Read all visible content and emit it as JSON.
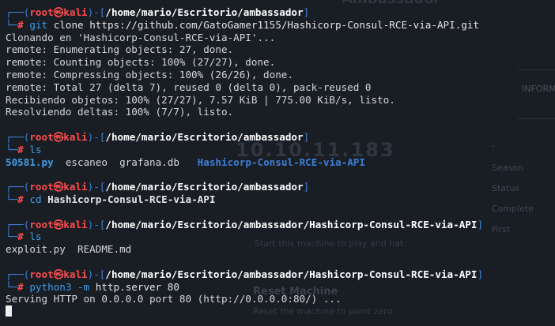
{
  "background_page": {
    "title": "Ambassador",
    "tab": "INFORM",
    "ip": "10.10.11.183",
    "stats": [
      "-",
      "Season",
      "Status",
      "Complete",
      "First"
    ],
    "start_text": "Start this machine to play and hat",
    "reset_title": "Reset Machine",
    "reset_desc": "Reset the machine to point zero"
  },
  "prompt": {
    "user": "root",
    "skull": "㉿",
    "host": "kali",
    "hash": "#"
  },
  "blocks": [
    {
      "cwd": "/home/mario/Escritorio/ambassador",
      "command": {
        "name": "git",
        "args": "clone https://github.com/GatoGamer1155/Hashicorp-Consul-RCE-via-API.git"
      },
      "output": [
        "Clonando en 'Hashicorp-Consul-RCE-via-API'...",
        "remote: Enumerating objects: 27, done.",
        "remote: Counting objects: 100% (27/27), done.",
        "remote: Compressing objects: 100% (26/26), done.",
        "remote: Total 27 (delta 7), reused 0 (delta 0), pack-reused 0",
        "Recibiendo objetos: 100% (27/27), 7.57 KiB | 775.00 KiB/s, listo.",
        "Resolviendo deltas: 100% (7/7), listo."
      ]
    },
    {
      "cwd": "/home/mario/Escritorio/ambassador",
      "command": {
        "name": "ls",
        "args": ""
      },
      "listing": [
        {
          "name": "50581.py",
          "kind": "py"
        },
        {
          "name": "escaneo",
          "kind": "file"
        },
        {
          "name": "grafana.db",
          "kind": "file"
        },
        {
          "name": "Hashicorp-Consul-RCE-via-API",
          "kind": "dir"
        }
      ]
    },
    {
      "cwd": "/home/mario/Escritorio/ambassador",
      "command": {
        "name": "cd",
        "args": "Hashicorp-Consul-RCE-via-API"
      }
    },
    {
      "cwd": "/home/mario/Escritorio/ambassador/Hashicorp-Consul-RCE-via-API",
      "command": {
        "name": "ls",
        "args": ""
      },
      "listing": [
        {
          "name": "exploit.py",
          "kind": "file"
        },
        {
          "name": "README.md",
          "kind": "file"
        }
      ]
    },
    {
      "cwd": "/home/mario/Escritorio/ambassador/Hashicorp-Consul-RCE-via-API",
      "command": {
        "name": "python3",
        "flag": "-m",
        "args": "http.server 80"
      },
      "output": [
        "Serving HTTP on 0.0.0.0 port 80 (http://0.0.0.0:80/) ..."
      ]
    }
  ]
}
